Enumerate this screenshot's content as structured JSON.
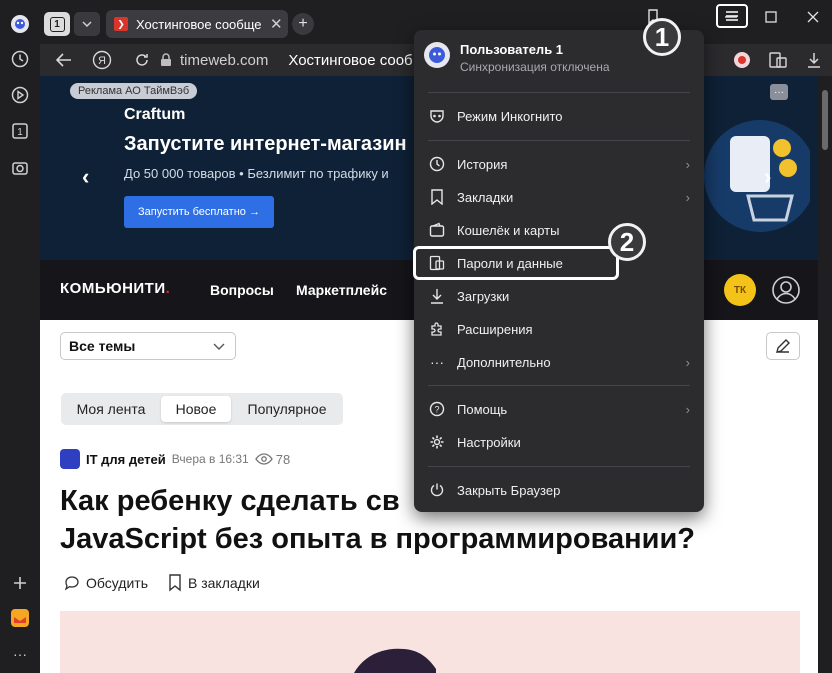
{
  "tabs": {
    "count": "1",
    "active_title": "Хостинговое сообщест",
    "close_glyph": "✕",
    "new_tab_glyph": "+"
  },
  "address_bar": {
    "domain": "timeweb.com",
    "page_title": "Хостинговое сооб"
  },
  "ad": {
    "badge": "Реклама АО ТаймВэб",
    "brand": "Craftum",
    "title": "Запустите интернет-магазин",
    "subtitle": "До 50 000 товаров • Безлимит по трафику и",
    "button": "Запустить бесплатно  →",
    "more": "···"
  },
  "site_nav": {
    "logo": "КОМЬЮНИТИ",
    "logo_dot": ".",
    "links": [
      "Вопросы",
      "Маркетплейс"
    ],
    "avatar_initials": "ТК"
  },
  "filter": {
    "selected": "Все темы"
  },
  "feed_tabs": [
    "Моя лента",
    "Новое",
    "Популярное"
  ],
  "post": {
    "author": "IT для детей",
    "time": "Вчера в 16:31",
    "views": "78",
    "headline": "Как ребенку сделать свой браузер без знания JavaScript без опыта в программировании?",
    "headline_line1": "Как ребенку сделать св",
    "headline_line2": "JavaScript без опыта в программировании?",
    "discuss": "Обсудить",
    "bookmark": "В закладки"
  },
  "menu": {
    "profile_name": "Пользователь 1",
    "profile_sync": "Синхронизация отключена",
    "items": [
      {
        "label": "Режим Инкогнито",
        "icon": "incognito-icon"
      },
      {
        "label": "История",
        "icon": "history-icon"
      },
      {
        "label": "Закладки",
        "icon": "bookmarks-icon"
      },
      {
        "label": "Кошелёк и карты",
        "icon": "wallet-icon"
      },
      {
        "label": "Пароли и данные",
        "icon": "passwords-icon"
      },
      {
        "label": "Загрузки",
        "icon": "downloads-icon"
      },
      {
        "label": "Расширения",
        "icon": "extensions-icon"
      },
      {
        "label": "Дополнительно",
        "icon": "more-icon"
      },
      {
        "label": "Помощь",
        "icon": "help-icon"
      },
      {
        "label": "Настройки",
        "icon": "settings-icon"
      },
      {
        "label": "Закрыть Браузер",
        "icon": "power-icon"
      }
    ]
  },
  "callouts": [
    "1",
    "2"
  ],
  "colors": {
    "chrome_bg": "#1f1f22",
    "menu_bg": "#2c2c2f",
    "ad_bg": "#0f2136",
    "ad_button": "#2f6fe6",
    "nav_bg": "#15151a",
    "logo_dot": "#e0262f",
    "avatar": "#f3c31a"
  }
}
